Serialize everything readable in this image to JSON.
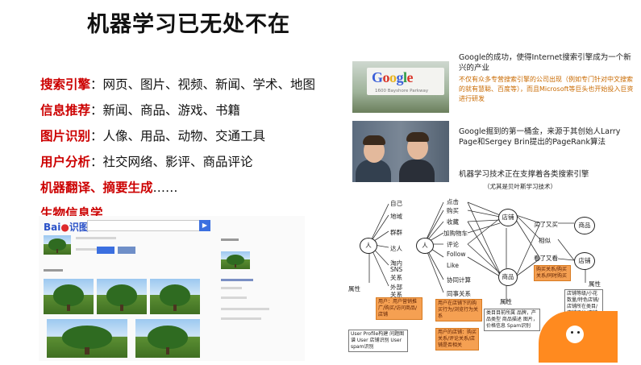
{
  "title": "机器学习已无处不在",
  "bullets": [
    {
      "label": "搜索引擎",
      "text": "：网页、图片、视频、新闻、学术、地图"
    },
    {
      "label": "信息推荐",
      "text": "：新闻、商品、游戏、书籍"
    },
    {
      "label": "图片识别",
      "text": "：人像、用品、动物、交通工具"
    },
    {
      "label": "用户分析",
      "text": "：社交网络、影评、商品评论"
    },
    {
      "label": "机器翻译、摘要生成",
      "text": "……"
    },
    {
      "label": "生物信息学",
      "text": "……"
    }
  ],
  "mock": {
    "logo_text": "Bai",
    "logo_suffix": "识图",
    "search_icon": "camera-icon"
  },
  "right": {
    "sign_logo": "Google",
    "sign_address": "1600 Bayshore Parkway",
    "text1": "Google的成功，使得Internet搜索引擎成为一个新兴的产业",
    "text1_orange": "不仅有众多专营搜索引擎的公司出现（例如专门针对中文搜索的就有慧聪、百度等），而且Microsoft等巨头也开始投入巨资进行研发",
    "text2": "Google掘到的第一桶金，来源于其创始人Larry Page和Sergey Brin提出的PageRank算法",
    "text3": "机器学习技术正在支撑着各类搜索引擎",
    "text3_small": "（尤其是贝叶斯学习技术）"
  },
  "diagram": {
    "person1": "人",
    "person2": "人",
    "shop": "店铺",
    "goods": "商品",
    "brand": "商品",
    "shop2": "店铺",
    "left_items": [
      "自己",
      "地域",
      "群群",
      "达人",
      "淘内",
      "SNS",
      "关系",
      "外部",
      "关系"
    ],
    "mid_items": [
      "点击",
      "购买",
      "收藏",
      "加购物车",
      "评论",
      "Follow",
      "Like",
      "协同计算",
      "同事关系"
    ],
    "right_items": [
      "买了又买",
      "相似",
      "看了又看"
    ],
    "attr1": "属性",
    "attr2": "属性",
    "attr3": "属性",
    "box1": "用户：用户营销推广/购买/访问商品/店铺",
    "box2": "用户在店铺下的购买行为/浏览行为关系",
    "box3": "用户的店铺：购买关系/评论关系/店铺是否相关",
    "box4": "购买关系/购买关系/同时购买",
    "box5": "类目目前所属 品牌，产品类型 商品描述 图片，价格信息 Spam识别",
    "box6": "店铺等级/小花数量/特色店铺/店铺所在类目/店铺评分/店铺spam率",
    "box7": "User Profile构建 问题图谱 User 店铺识别 User spam识别",
    "mascot": "mascot-icon"
  }
}
